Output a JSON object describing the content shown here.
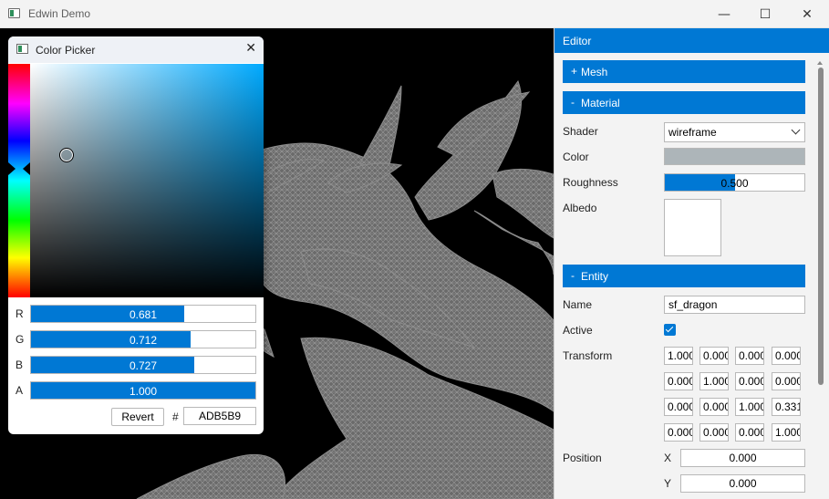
{
  "window": {
    "title": "Edwin Demo",
    "controls": {
      "minimize": "—",
      "maximize": "☐",
      "close": "✕"
    }
  },
  "color_picker": {
    "title": "Color Picker",
    "close_glyph": "✕",
    "channels": [
      {
        "label": "R",
        "value": "0.681",
        "level": 0.681
      },
      {
        "label": "G",
        "value": "0.712",
        "level": 0.712
      },
      {
        "label": "B",
        "value": "0.727",
        "level": 0.727
      },
      {
        "label": "A",
        "value": "1.000",
        "level": 1.0
      }
    ],
    "revert_label": "Revert",
    "hash_label": "#",
    "hex_value": "ADB5B9"
  },
  "editor": {
    "title": "Editor",
    "sections": {
      "mesh": {
        "sign": "+",
        "title": "Mesh"
      },
      "material": {
        "sign": "-",
        "title": "Material"
      },
      "entity": {
        "sign": "-",
        "title": "Entity"
      }
    },
    "material": {
      "shader_label": "Shader",
      "shader_value": "wireframe",
      "color_label": "Color",
      "color_value": "#adb5b9",
      "roughness_label": "Roughness",
      "roughness_value": "0.500",
      "roughness_level": 0.5,
      "albedo_label": "Albedo"
    },
    "entity": {
      "name_label": "Name",
      "name_value": "sf_dragon",
      "active_label": "Active",
      "active_checked": true,
      "transform_label": "Transform",
      "transform": [
        [
          "1.000",
          "0.000",
          "0.000",
          "0.000"
        ],
        [
          "0.000",
          "1.000",
          "0.000",
          "0.000"
        ],
        [
          "0.000",
          "0.000",
          "1.000",
          "0.331"
        ],
        [
          "0.000",
          "0.000",
          "0.000",
          "1.000"
        ]
      ],
      "position_label": "Position",
      "position": [
        {
          "axis": "X",
          "value": "0.000"
        },
        {
          "axis": "Y",
          "value": "0.000"
        }
      ]
    }
  },
  "colors": {
    "accent": "#0078d4",
    "viewport_bg": "#000000",
    "wireframe": "#8a8a8a"
  }
}
